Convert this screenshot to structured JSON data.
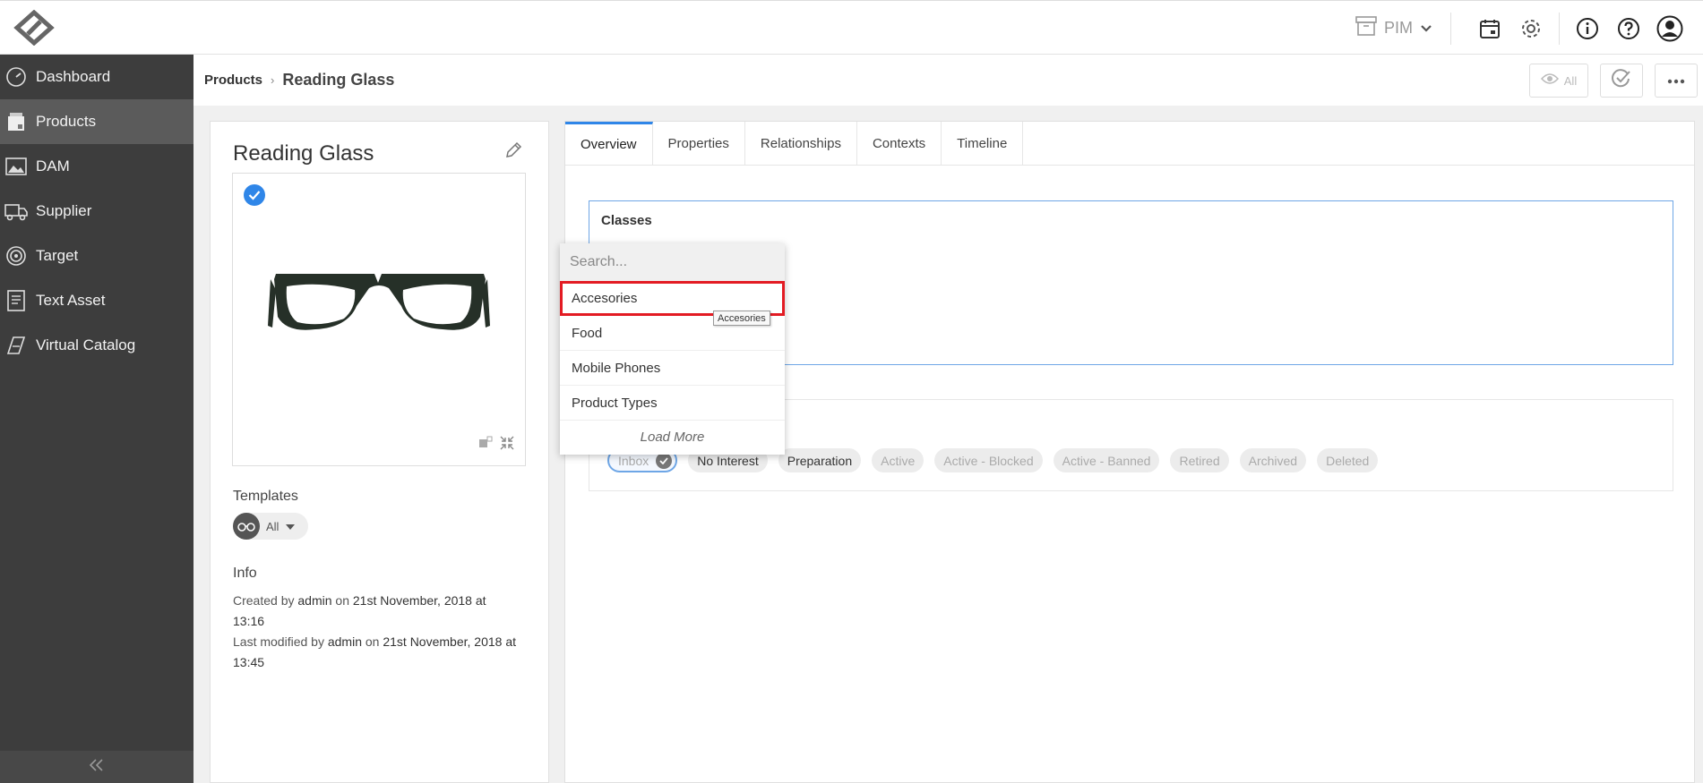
{
  "topbar": {
    "module": "PIM"
  },
  "sidebar": {
    "items": [
      {
        "label": "Dashboard"
      },
      {
        "label": "Products"
      },
      {
        "label": "DAM"
      },
      {
        "label": "Supplier"
      },
      {
        "label": "Target"
      },
      {
        "label": "Text Asset"
      },
      {
        "label": "Virtual Catalog"
      }
    ]
  },
  "header": {
    "breadcrumb_root": "Products",
    "breadcrumb_current": "Reading Glass",
    "view_filter": "All"
  },
  "product": {
    "title": "Reading Glass",
    "templates_label": "Templates",
    "template_filter": "All",
    "info_label": "Info",
    "created_prefix": "Created by",
    "created_user": "admin",
    "created_on": "on",
    "created_date": "21st November, 2018 at 13:16",
    "modified_prefix": "Last modified by",
    "modified_user": "admin",
    "modified_on": "on",
    "modified_date": "21st November, 2018 at 13:45"
  },
  "tabs": [
    {
      "label": "Overview"
    },
    {
      "label": "Properties"
    },
    {
      "label": "Relationships"
    },
    {
      "label": "Contexts"
    },
    {
      "label": "Timeline"
    }
  ],
  "classes": {
    "title": "Classes"
  },
  "dropdown": {
    "search_placeholder": "Search...",
    "items": [
      {
        "label": "Accesories"
      },
      {
        "label": "Food"
      },
      {
        "label": "Mobile Phones"
      },
      {
        "label": "Product Types"
      }
    ],
    "load_more": "Load More",
    "tooltip": "Accesories"
  },
  "statuses": [
    {
      "label": "Inbox"
    },
    {
      "label": "No Interest"
    },
    {
      "label": "Preparation"
    },
    {
      "label": "Active"
    },
    {
      "label": "Active - Blocked"
    },
    {
      "label": "Active - Banned"
    },
    {
      "label": "Retired"
    },
    {
      "label": "Archived"
    },
    {
      "label": "Deleted"
    }
  ],
  "colors": {
    "sidebar_bg": "#3d3d3d",
    "sidebar_active": "#5b5b5b",
    "accent": "#2f86e8",
    "highlight": "#e31b23"
  }
}
